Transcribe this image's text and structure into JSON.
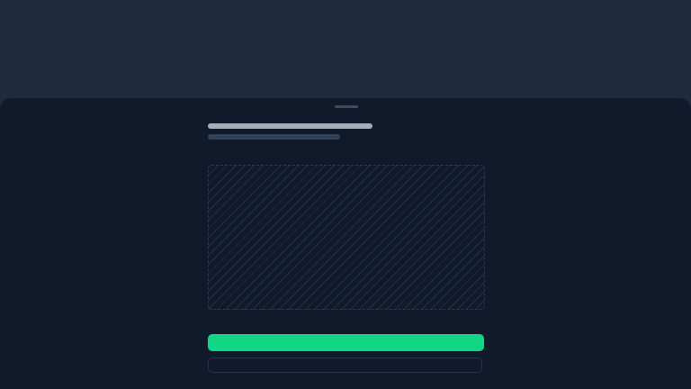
{
  "sheet": {
    "title": "",
    "subtitle": "",
    "primary_label": "",
    "secondary_label": ""
  },
  "colors": {
    "backdrop": "#1f2a3d",
    "sheet": "#111a2b",
    "accent": "#11d685",
    "title_skeleton": "#a6adb8",
    "subtitle_skeleton": "#334259"
  }
}
